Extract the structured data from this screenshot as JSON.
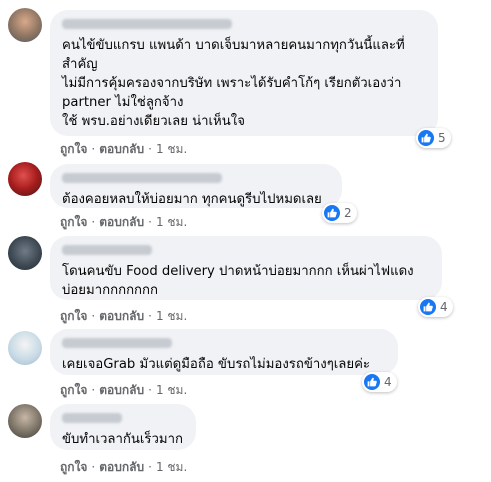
{
  "colors": {
    "like_blue": "#1877f2",
    "bubble_bg": "#f0f2f5",
    "meta_text": "#65676b"
  },
  "comments": [
    {
      "text": "คนไข้ขับแกรบ แพนด้า บาดเจ็บมาหลายคนมากทุกวันนี้และที่\nสำคัญ\nไม่มีการคุ้มครองจากบริษัท เพราะได้รับคำโก้ๆ เรียกตัวเองว่า\npartner ไม่ใช่ลูกจ้าง\nใช้ พรบ.อย่างเดียวเลย น่าเห็นใจ",
      "like_label": "ถูกใจ",
      "reply_label": "ตอบกลับ",
      "time": "1 ชม.",
      "reactions": "5",
      "reaction_icon": "like-icon"
    },
    {
      "text": "ต้องคอยหลบให้บ่อยมาก ทุกคนดูรีบไปหมดเลย",
      "like_label": "ถูกใจ",
      "reply_label": "ตอบกลับ",
      "time": "1 ชม.",
      "reactions": "2",
      "reaction_icon": "like-icon"
    },
    {
      "text": "โดนคนขับ Food delivery ปาดหน้าบ่อยมากกก เห็นผ่าไฟแดง\nบ่อยมากกกกกกก",
      "like_label": "ถูกใจ",
      "reply_label": "ตอบกลับ",
      "time": "1 ชม.",
      "reactions": "4",
      "reaction_icon": "like-icon"
    },
    {
      "text": "เคยเจอGrab มัวแต่ดูมือถือ ขับรถไม่มองรถข้างๆเลยค่ะ",
      "like_label": "ถูกใจ",
      "reply_label": "ตอบกลับ",
      "time": "1 ชม.",
      "reactions": "4",
      "reaction_icon": "like-icon"
    },
    {
      "text": "ขับทำเวลากันเร็วมาก",
      "like_label": "ถูกใจ",
      "reply_label": "ตอบกลับ",
      "time": "1 ชม.",
      "reactions": "",
      "reaction_icon": ""
    }
  ]
}
